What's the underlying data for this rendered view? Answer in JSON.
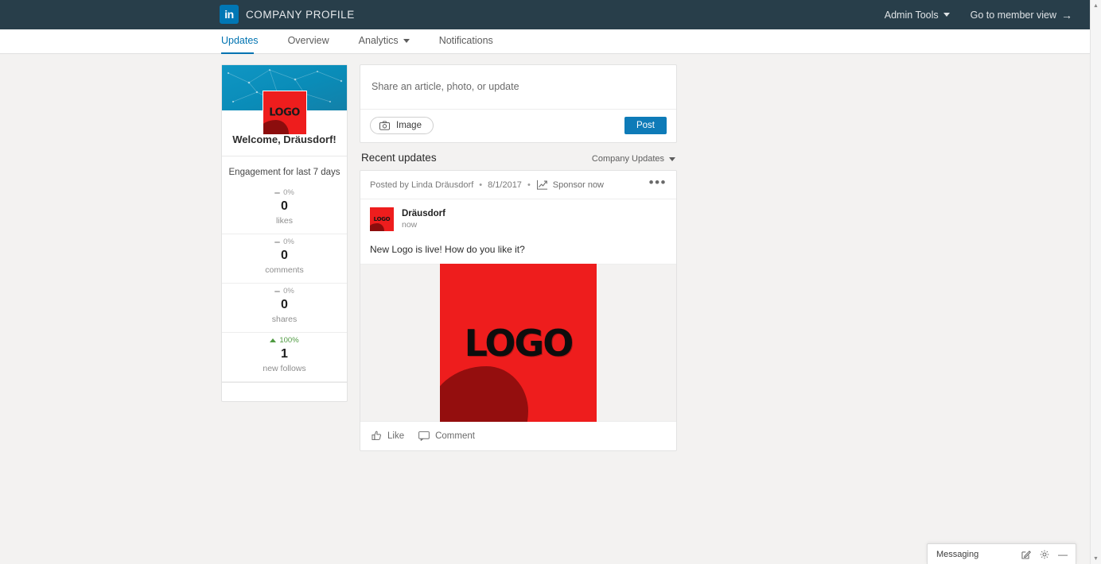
{
  "topbar": {
    "logo_text": "in",
    "title": "COMPANY PROFILE",
    "admin_tools": "Admin Tools",
    "member_view": "Go to member view",
    "arrow": "→"
  },
  "nav": {
    "tabs": [
      {
        "label": "Updates",
        "active": true,
        "has_caret": false
      },
      {
        "label": "Overview",
        "active": false,
        "has_caret": false
      },
      {
        "label": "Analytics",
        "active": false,
        "has_caret": true
      },
      {
        "label": "Notifications",
        "active": false,
        "has_caret": false
      }
    ]
  },
  "sidebar": {
    "logo_text": "LOGO",
    "welcome": "Welcome, Dräusdorf!",
    "engagement_title": "Engagement for last 7 days",
    "stats": [
      {
        "delta": "0%",
        "direction": "flat",
        "value": "0",
        "label": "likes"
      },
      {
        "delta": "0%",
        "direction": "flat",
        "value": "0",
        "label": "comments"
      },
      {
        "delta": "0%",
        "direction": "flat",
        "value": "0",
        "label": "shares"
      },
      {
        "delta": "100%",
        "direction": "up",
        "value": "1",
        "label": "new follows"
      }
    ]
  },
  "share": {
    "placeholder": "Share an article, photo, or update",
    "image_label": "Image",
    "post_label": "Post"
  },
  "recent": {
    "title": "Recent updates",
    "filter_label": "Company Updates"
  },
  "post": {
    "posted_by": "Posted by Linda Dräusdorf",
    "date": "8/1/2017",
    "sponsor_label": "Sponsor now",
    "menu": "•••",
    "author": "Dräusdorf",
    "time": "now",
    "text": "New Logo is live! How do you like it?",
    "image_text": "LOGO",
    "like_label": "Like",
    "comment_label": "Comment"
  },
  "messaging": {
    "label": "Messaging",
    "minimize": "—"
  },
  "colors": {
    "topbar_bg": "#283e4a",
    "accent": "#0073b1",
    "post_button": "#0e7bb8",
    "logo_red": "#ee1d1d",
    "banner_teal": "#0a8cb8",
    "positive_green": "#4f9a41",
    "page_bg": "#f3f2f1"
  }
}
